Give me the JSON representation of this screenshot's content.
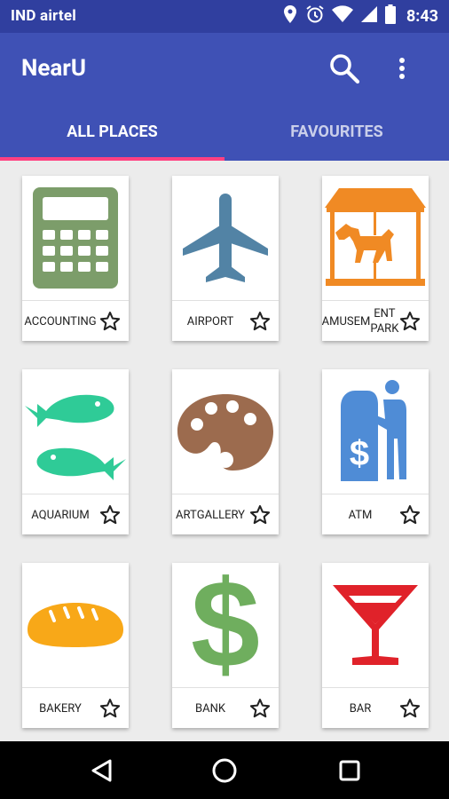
{
  "status_bar": {
    "carrier": "IND airtel",
    "time": "8:43",
    "icons": [
      "location-icon",
      "alarm-icon",
      "wifi-icon",
      "cell-signal-icon",
      "battery-icon"
    ]
  },
  "app_bar": {
    "title": "NearU",
    "actions": [
      "search-icon",
      "more-vert-icon"
    ]
  },
  "tabs": [
    {
      "label": "ALL PLACES",
      "selected": true
    },
    {
      "label": "FAVOURITES",
      "selected": false
    }
  ],
  "places": [
    {
      "label_lines": [
        "ACCOUNT",
        "ING"
      ],
      "icon": "calculator-icon",
      "favourite": false
    },
    {
      "label_lines": [
        "AIRPORT"
      ],
      "icon": "airplane-icon",
      "favourite": false
    },
    {
      "label_lines": [
        "AMUSEM",
        "ENT PARK"
      ],
      "icon": "carousel-icon",
      "favourite": false
    },
    {
      "label_lines": [
        "AQUARIU",
        "M"
      ],
      "icon": "fish-icon",
      "favourite": false
    },
    {
      "label_lines": [
        "ART",
        "GALLERY"
      ],
      "icon": "palette-icon",
      "favourite": false
    },
    {
      "label_lines": [
        "ATM"
      ],
      "icon": "atm-icon",
      "favourite": false
    },
    {
      "label_lines": [
        "BAKERY"
      ],
      "icon": "bread-icon",
      "favourite": false
    },
    {
      "label_lines": [
        "BANK"
      ],
      "icon": "dollar-icon",
      "favourite": false
    },
    {
      "label_lines": [
        "BAR"
      ],
      "icon": "cocktail-glass-icon",
      "favourite": false
    }
  ],
  "nav_bar": [
    "back-icon",
    "home-icon",
    "recents-icon"
  ],
  "colors": {
    "status_bar": "#303F9F",
    "app_bar": "#3F51B5",
    "tab_indicator": "#FF4081",
    "background": "#ECECEC",
    "calculator": "#7C9D6A",
    "airplane": "#5283A5",
    "carousel": "#F08A24",
    "fish": "#2FCB97",
    "palette": "#9C6B4E",
    "atm": "#4F8CD6",
    "bread": "#F8A818",
    "dollar": "#6FAE5E",
    "cocktail": "#E0222A"
  }
}
